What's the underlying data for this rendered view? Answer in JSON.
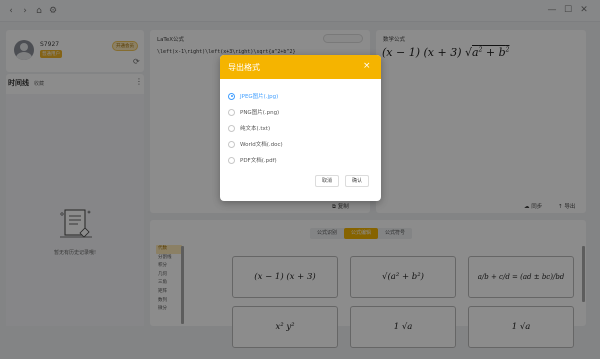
{
  "user": {
    "name": "S7927",
    "badge": "普通用户",
    "vip_button": "开通会员"
  },
  "history": {
    "title": "时间线",
    "link": "收藏",
    "empty_text": "暂无有历史记录哦!"
  },
  "latex_panel": {
    "title": "LaTeX公式",
    "code": "\\left(x-1\\right)\\left(x+3\\right)\\sqrt{a^2+b^2}",
    "copy_label": "复制"
  },
  "math_panel": {
    "title": "数学公式",
    "formula_main": "(x − 1) (x + 3) √",
    "formula_radicand": "a",
    "formula_plus": " + b",
    "share_label": "同步",
    "export_label": "导出"
  },
  "symbols": {
    "tabs": [
      "公式识别",
      "公式编辑",
      "公式符号"
    ],
    "active_tab_index": 1,
    "categories": [
      "代数",
      "分割线",
      "积分",
      "几何",
      "三角",
      "矩阵",
      "数列",
      "微分"
    ],
    "active_category_index": 0,
    "tiles": [
      "(x − 1) (x + 3)",
      "√(a² + b²)",
      "a/b + c/d = (ad ± bc)/bd",
      "x²    y²",
      "1    √a",
      "1    √a"
    ]
  },
  "dialog": {
    "title": "导出格式",
    "options": [
      "JPEG图片(.jpg)",
      "PNG图片(.png)",
      "纯文本(.txt)",
      "World文档(.doc)",
      "PDF文档(.pdf)"
    ],
    "selected_index": 0,
    "cancel_label": "取消",
    "confirm_label": "确认"
  },
  "colors": {
    "accent": "#f5b400",
    "selected_option": "#409eff"
  }
}
